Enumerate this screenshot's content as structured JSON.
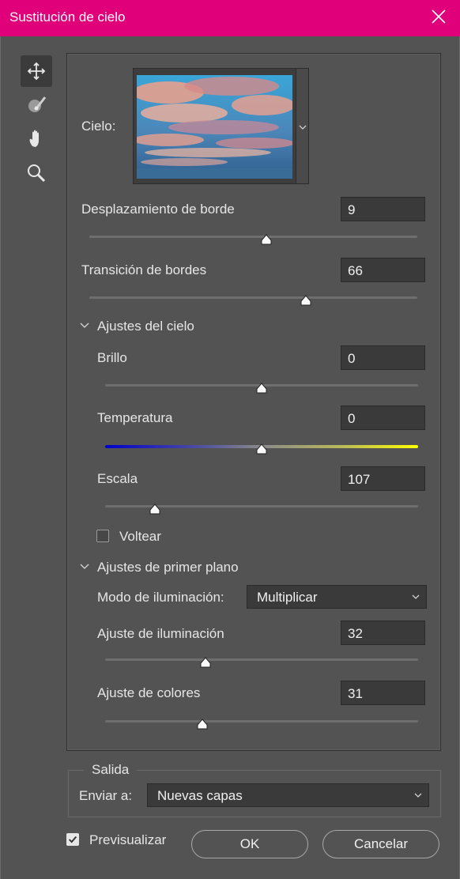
{
  "window": {
    "title": "Sustitución de cielo"
  },
  "tools": [
    {
      "icon": "move-icon",
      "active": true
    },
    {
      "icon": "sky-brush-icon",
      "active": false
    },
    {
      "icon": "hand-icon",
      "active": false
    },
    {
      "icon": "zoom-icon",
      "active": false
    }
  ],
  "sky": {
    "label": "Cielo:"
  },
  "edge_shift": {
    "label": "Desplazamiento de borde",
    "value": "9",
    "slider_fraction": 0.54
  },
  "fade_edge": {
    "label": "Transición de bordes",
    "value": "66",
    "slider_fraction": 0.66
  },
  "sky_adjustments": {
    "header": "Ajustes del cielo",
    "brightness": {
      "label": "Brillo",
      "value": "0",
      "slider_fraction": 0.5
    },
    "temperature": {
      "label": "Temperatura",
      "value": "0",
      "slider_fraction": 0.5
    },
    "scale": {
      "label": "Escala",
      "value": "107",
      "slider_fraction": 0.16
    },
    "flip": {
      "label": "Voltear",
      "checked": false
    }
  },
  "foreground_adjustments": {
    "header": "Ajustes de primer plano",
    "lighting_mode": {
      "label": "Modo de iluminación:",
      "value": "Multiplicar"
    },
    "lighting_adjust": {
      "label": "Ajuste de iluminación",
      "value": "32",
      "slider_fraction": 0.32
    },
    "color_adjust": {
      "label": "Ajuste de colores",
      "value": "31",
      "slider_fraction": 0.31
    }
  },
  "output": {
    "legend": "Salida",
    "send_to_label": "Enviar a:",
    "send_to_value": "Nuevas capas"
  },
  "footer": {
    "preview_label": "Previsualizar",
    "preview_checked": true,
    "ok_label": "OK",
    "cancel_label": "Cancelar"
  },
  "colors": {
    "titlebar": "#e0007a",
    "background": "#535353",
    "field": "#3a3a3a"
  }
}
